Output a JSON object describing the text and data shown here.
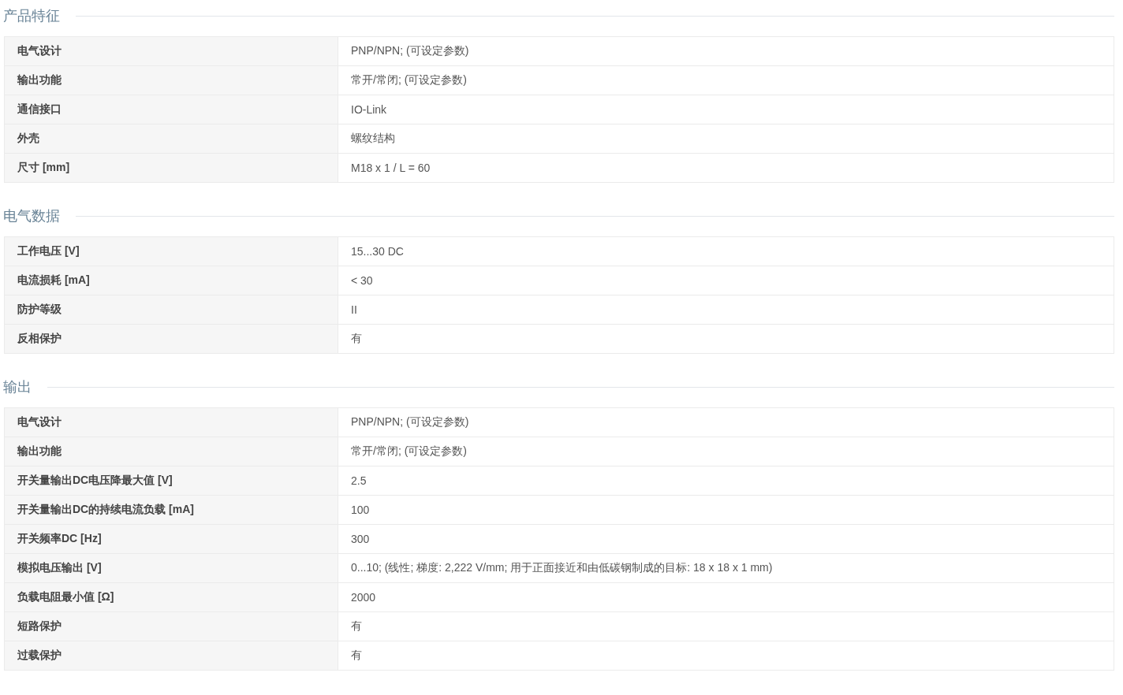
{
  "sections": [
    {
      "title": "产品特征",
      "rows": [
        {
          "label": "电气设计",
          "value": "PNP/NPN; (可设定参数)"
        },
        {
          "label": "输出功能",
          "value": "常开/常闭; (可设定参数)"
        },
        {
          "label": "通信接口",
          "value": "IO-Link"
        },
        {
          "label": "外壳",
          "value": "螺纹结构"
        },
        {
          "label": "尺寸 [mm]",
          "value": "M18 x 1 / L = 60"
        }
      ]
    },
    {
      "title": "电气数据",
      "rows": [
        {
          "label": "工作电压 [V]",
          "value": "15...30 DC"
        },
        {
          "label": "电流损耗 [mA]",
          "value": "< 30"
        },
        {
          "label": "防护等级",
          "value": "II"
        },
        {
          "label": "反相保护",
          "value": "有"
        }
      ]
    },
    {
      "title": "输出",
      "rows": [
        {
          "label": "电气设计",
          "value": "PNP/NPN; (可设定参数)"
        },
        {
          "label": "输出功能",
          "value": "常开/常闭; (可设定参数)"
        },
        {
          "label": "开关量输出DC电压降最大值 [V]",
          "value": "2.5"
        },
        {
          "label": "开关量输出DC的持续电流负载 [mA]",
          "value": "100"
        },
        {
          "label": "开关频率DC [Hz]",
          "value": "300"
        },
        {
          "label": "模拟电压输出 [V]",
          "value": "0...10; (线性; 梯度: 2,222 V/mm; 用于正面接近和由低碳钢制成的目标: 18 x 18 x 1 mm)"
        },
        {
          "label": "负载电阻最小值 [Ω]",
          "value": "2000"
        },
        {
          "label": "短路保护",
          "value": "有"
        },
        {
          "label": "过载保护",
          "value": "有"
        }
      ]
    }
  ]
}
